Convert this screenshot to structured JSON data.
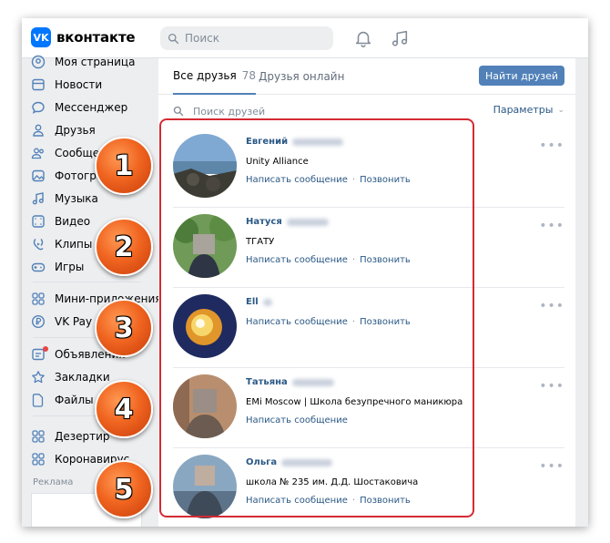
{
  "header": {
    "logo_text": "вконтакте",
    "search_placeholder": "Поиск"
  },
  "sidebar": {
    "items": [
      {
        "label": "Моя страница",
        "icon": "user-circle-icon"
      },
      {
        "label": "Новости",
        "icon": "news-icon"
      },
      {
        "label": "Мессенджер",
        "icon": "chat-bubble-icon"
      },
      {
        "label": "Друзья",
        "icon": "user-icon"
      },
      {
        "label": "Сообщества",
        "icon": "users-icon"
      },
      {
        "label": "Фотографии",
        "icon": "photo-icon"
      },
      {
        "label": "Музыка",
        "icon": "music-icon"
      },
      {
        "label": "Видео",
        "icon": "video-icon"
      },
      {
        "label": "Клипы",
        "icon": "clips-icon"
      },
      {
        "label": "Игры",
        "icon": "gamepad-icon"
      },
      {
        "label": "Мини-приложения",
        "icon": "apps-icon"
      },
      {
        "label": "VK Pay",
        "icon": "vk-pay-icon"
      },
      {
        "label": "Объявления",
        "icon": "ads-icon"
      },
      {
        "label": "Закладки",
        "icon": "star-icon"
      },
      {
        "label": "Файлы",
        "icon": "file-icon"
      },
      {
        "label": "Дезертир",
        "icon": "apps-icon"
      },
      {
        "label": "Коронавирус",
        "icon": "apps-icon"
      }
    ],
    "ads_label": "Реклама"
  },
  "friends": {
    "tab_all": "Все друзья",
    "tab_all_count": "78",
    "tab_online": "Друзья онлайн",
    "find_button": "Найти друзей",
    "search_placeholder": "Поиск друзей",
    "params_label": "Параметры",
    "list": [
      {
        "name": "Евгений",
        "subtitle": "Unity Alliance",
        "write": "Написать сообщение",
        "call": "Позвонить"
      },
      {
        "name": "Натуся",
        "subtitle": "ТГАТУ",
        "write": "Написать сообщение",
        "call": "Позвонить"
      },
      {
        "name": "Ell",
        "subtitle": "",
        "write": "Написать сообщение",
        "call": "Позвонить"
      },
      {
        "name": "Татьяна",
        "subtitle": "EMi Moscow | Школа безупречного маникюра",
        "write": "Написать сообщение",
        "call": ""
      },
      {
        "name": "Ольга",
        "subtitle": "школа № 235 им. Д.Д. Шостаковича",
        "write": "Написать сообщение",
        "call": "Позвонить"
      }
    ]
  },
  "badges": [
    "1",
    "2",
    "3",
    "4",
    "5"
  ],
  "colors": {
    "brand": "#0077ff",
    "link": "#2a5885",
    "button": "#5181b8",
    "highlight": "#d42a33",
    "badge": "#f06520"
  }
}
